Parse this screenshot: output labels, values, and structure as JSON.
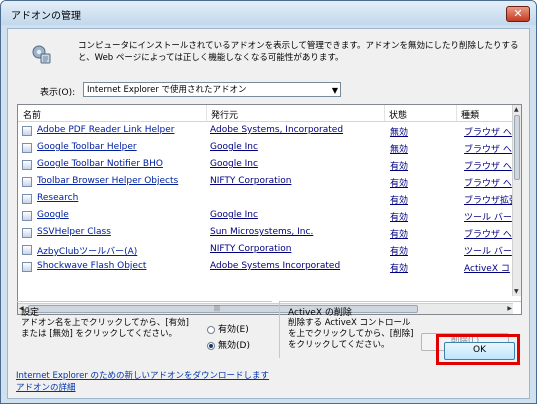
{
  "window": {
    "title": "アドオンの管理",
    "close_label": "✕"
  },
  "header": {
    "description": "コンピュータにインストールされているアドオンを表示して管理できます。アドオンを無効にしたり削除したりすると、Web ページによっては正しく機能しなくなる可能性があります。"
  },
  "filter": {
    "label": "表示(O):",
    "selected": "Internet Explorer で使用されたアドオン"
  },
  "table": {
    "columns": [
      "名前",
      "発行元",
      "状態",
      "種類"
    ],
    "rows": [
      {
        "name": "Adobe PDF Reader Link Helper",
        "publisher": "Adobe Systems, Incorporated",
        "status": "無効",
        "type": "ブラウザ へ"
      },
      {
        "name": "Google Toolbar Helper",
        "publisher": "Google Inc",
        "status": "無効",
        "type": "ブラウザ へ"
      },
      {
        "name": "Google Toolbar Notifier BHO",
        "publisher": "Google Inc",
        "status": "有効",
        "type": "ブラウザ へ"
      },
      {
        "name": "Toolbar Browser Helper Objects",
        "publisher": "NIFTY Corporation",
        "status": "有効",
        "type": "ブラウザ へ"
      },
      {
        "name": "Research",
        "publisher": "",
        "status": "有効",
        "type": "ブラウザ拡張"
      },
      {
        "name": "Google",
        "publisher": "Google Inc",
        "status": "有効",
        "type": "ツール バー"
      },
      {
        "name": "SSVHelper Class",
        "publisher": "Sun Microsystems, Inc.",
        "status": "有効",
        "type": "ブラウザ へ"
      },
      {
        "name": "AzbyClubツールバー(A)",
        "publisher": "NIFTY Corporation",
        "status": "有効",
        "type": "ツール バー"
      },
      {
        "name": "Shockwave Flash Object",
        "publisher": "Adobe Systems Incorporated",
        "status": "有効",
        "type": "ActiveX コ"
      }
    ],
    "hscroll_grip": "|||"
  },
  "settings": {
    "title": "設定",
    "text": "アドオン名を上でクリックしてから、[有効] または [無効] をクリックしてください。",
    "enable_label": "有効(E)",
    "disable_label": "無効(D)"
  },
  "activex": {
    "title": "ActiveX の削除",
    "text": "削除する ActiveX コントロールを上でクリックしてから、[削除] をクリックしてください。",
    "delete_label": "削除(L)"
  },
  "links": {
    "download": "Internet Explorer のための新しいアドオンをダウンロードします",
    "details": "アドオンの詳細"
  },
  "ok_label": "OK",
  "colors": {
    "highlight": "#e00000",
    "link": "#0033aa"
  }
}
